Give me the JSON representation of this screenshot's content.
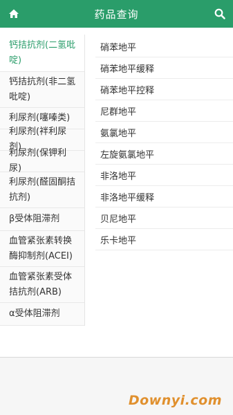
{
  "header": {
    "title": "药品查询",
    "home_icon": "home-icon",
    "search_icon": "search-icon",
    "color": "#2a9d6a"
  },
  "sidebar": {
    "categories": [
      {
        "label": "钙拮抗剂(二氢吡啶)",
        "active": true
      },
      {
        "label": "钙拮抗剂(非二氢吡啶)",
        "active": false
      },
      {
        "label": "利尿剂(噻嗪类)",
        "active": false
      },
      {
        "label": "利尿剂(袢利尿剂)",
        "active": false
      },
      {
        "label": "利尿剂(保钾利尿)",
        "active": false
      },
      {
        "label": "利尿剂(醛固酮拮抗剂)",
        "active": false
      },
      {
        "label": "β受体阻滞剂",
        "active": false
      },
      {
        "label": "血管紧张素转换酶抑制剂(ACEI)",
        "active": false
      },
      {
        "label": "血管紧张素受体拮抗剂(ARB)",
        "active": false
      },
      {
        "label": "α受体阻滞剂",
        "active": false
      }
    ]
  },
  "drugs": [
    "硝苯地平",
    "硝苯地平缓释",
    "硝苯地平控释",
    "尼群地平",
    "氨氯地平",
    "左旋氨氯地平",
    "非洛地平",
    "非洛地平缓释",
    "贝尼地平",
    "乐卡地平"
  ],
  "watermark": "Downyi.com"
}
